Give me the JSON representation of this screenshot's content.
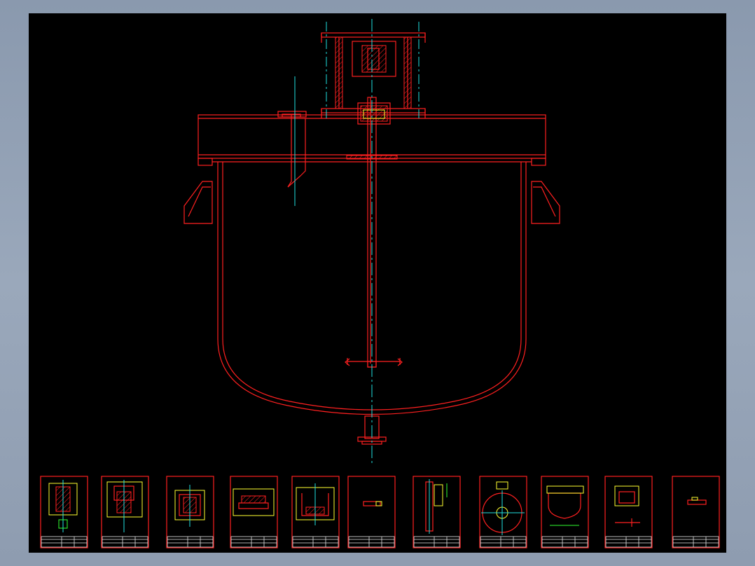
{
  "drawing": {
    "background_color": "#000000",
    "frame_color": "#8e9cb0",
    "line_colors": {
      "outline": "#ff2020",
      "centerline": "#20e0e0",
      "detail": "#ffff30",
      "dimension": "#30ff30"
    },
    "main_view": "reactor-vessel-section",
    "sheet_count": 11
  }
}
